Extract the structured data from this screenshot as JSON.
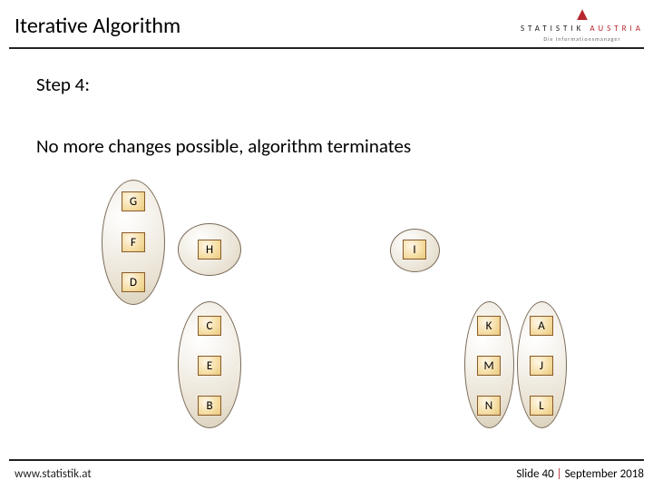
{
  "logo": {
    "line1_pre": "STATISTIK ",
    "line1_accent": "AUSTRIA",
    "line2": "Die Informationsmanager"
  },
  "title": "Iterative Algorithm",
  "step": "Step 4:",
  "desc": "No more changes possible, algorithm terminates",
  "nodes": {
    "G": "G",
    "F": "F",
    "D": "D",
    "H": "H",
    "I": "I",
    "C": "C",
    "E": "E",
    "B": "B",
    "K": "K",
    "M": "M",
    "N": "N",
    "A": "A",
    "J": "J",
    "L": "L"
  },
  "footer": {
    "url": "www.statistik.at",
    "slide_label": "Slide 40",
    "sep": " | ",
    "date": "September 2018"
  }
}
